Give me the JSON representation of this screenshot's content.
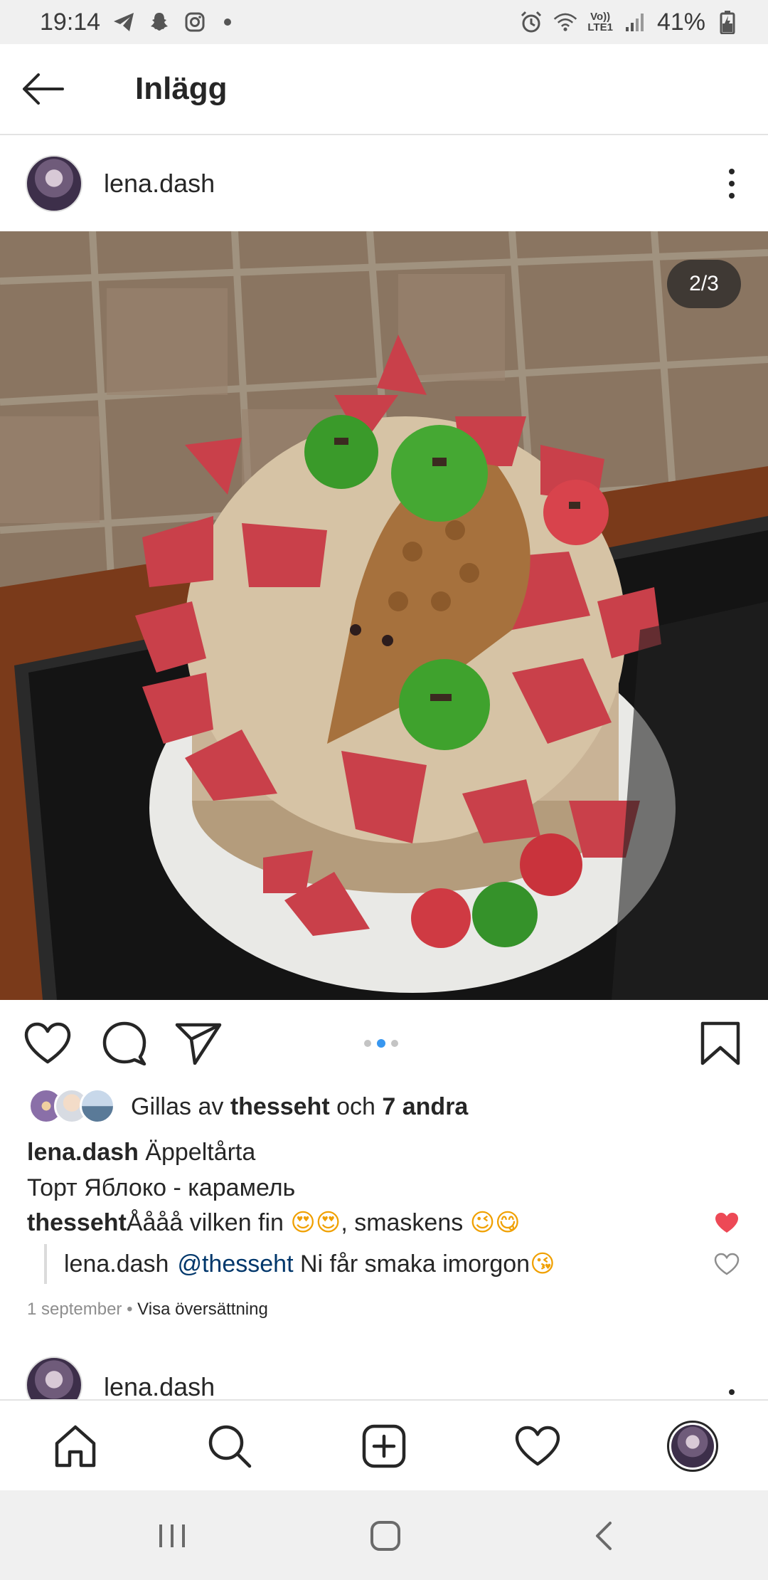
{
  "status_bar": {
    "time": "19:14",
    "battery": "41%",
    "network_top": "Vo))",
    "network_bottom": "LTE1"
  },
  "top_bar": {
    "title": "Inlägg"
  },
  "post": {
    "username": "lena.dash",
    "page_counter": "2/3",
    "carousel": {
      "total": 3,
      "active": 2
    },
    "likes": {
      "prefix": "Gillas av",
      "user": "thesseht",
      "connector": "och",
      "others": "7 andra"
    },
    "caption": {
      "user": "lena.dash",
      "line1": "Äppeltårta",
      "line2": "Торт Яблоко - карамель"
    },
    "comment": {
      "user": "thesseht",
      "text_a": "Åååå vilken fin ",
      "emoji_a": "😍😍",
      "text_b": ", smaskens ",
      "emoji_b": "😉😋",
      "liked": true
    },
    "reply": {
      "user": "lena.dash",
      "mention": "@thesseht",
      "text": " Ni får smaka imorgon",
      "emoji": "😘",
      "liked": false
    },
    "meta": {
      "date": "1 september",
      "separator": " • ",
      "translate": "Visa översättning"
    }
  },
  "next_post": {
    "username": "lena.dash"
  },
  "colors": {
    "accent_blue": "#3897f0",
    "like_red": "#ed4956",
    "text": "#262626",
    "muted": "#8e8e8e"
  },
  "icons": {
    "back": "arrow-left-icon",
    "like": "heart-icon",
    "comment": "comment-bubble-icon",
    "share": "paper-plane-icon",
    "save": "bookmark-icon",
    "home": "home-icon",
    "search": "search-icon",
    "add": "add-post-icon",
    "activity": "heart-icon"
  }
}
